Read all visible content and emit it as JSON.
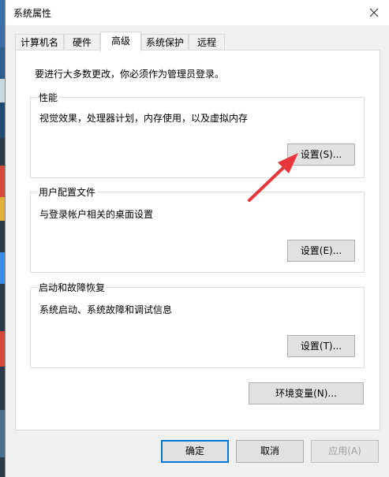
{
  "window": {
    "title": "系统属性",
    "close_glyph": "✕"
  },
  "tabs": [
    {
      "label": "计算机名"
    },
    {
      "label": "硬件"
    },
    {
      "label": "高级"
    },
    {
      "label": "系统保护"
    },
    {
      "label": "远程"
    }
  ],
  "active_tab": "高级",
  "panel": {
    "notice": "要进行大多数更改，你必须作为管理员登录。",
    "performance": {
      "title": "性能",
      "desc": "视觉效果，处理器计划，内存使用，以及虚拟内存",
      "button": "设置(S)..."
    },
    "profiles": {
      "title": "用户配置文件",
      "desc": "与登录帐户相关的桌面设置",
      "button": "设置(E)..."
    },
    "startup": {
      "title": "启动和故障恢复",
      "desc": "系统启动、系统故障和调试信息",
      "button": "设置(T)..."
    },
    "env_button": "环境变量(N)..."
  },
  "footer": {
    "ok": "确定",
    "cancel": "取消",
    "apply": "应用(A)"
  },
  "colors": {
    "annotation_arrow": "#e8363a",
    "default_button_border": "#0078d7"
  }
}
